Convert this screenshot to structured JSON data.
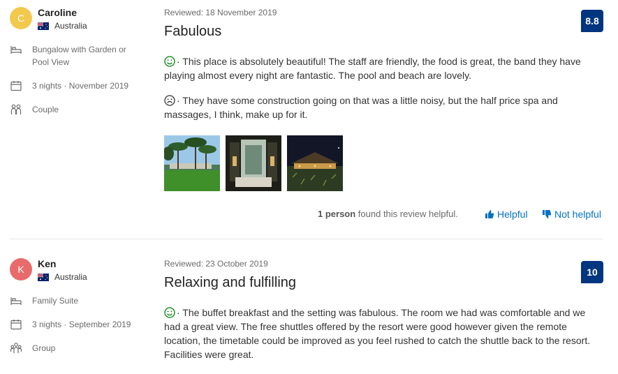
{
  "reviews": [
    {
      "avatar_letter": "C",
      "avatar_color": "#f2c94c",
      "name": "Caroline",
      "country": "Australia",
      "room": "Bungalow with Garden or Pool View",
      "nights": "3 nights ·",
      "stay_date": "November 2019",
      "traveler_type": "Couple",
      "reviewed": "Reviewed: 18 November 2019",
      "title": "Fabulous",
      "score": "8.8",
      "positive": "· This place is absolutely beautiful! The staff are friendly, the food is great, the band they have playing almost every night are fantastic. The pool and beach are lovely.",
      "negative": "· They have some construction going on that was a little noisy, but the half price spa and massages, I think, make up for it.",
      "helpful_bold": "1 person",
      "helpful_rest": " found this review helpful.",
      "helpful_label": "Helpful",
      "not_helpful_label": "Not helpful"
    },
    {
      "avatar_letter": "K",
      "avatar_color": "#e86a6a",
      "name": "Ken",
      "country": "Australia",
      "room": "Family Suite",
      "nights": "3 nights ·",
      "stay_date": "September 2019",
      "traveler_type": "Group",
      "reviewed": "Reviewed: 23 October 2019",
      "title": "Relaxing and fulfilling",
      "score": "10",
      "positive": "· The buffet breakfast and the setting was fabulous. The room we had was comfortable and we had a great view. The free shuttles offered by the resort were good however given the remote location, the timetable could be improved as you feel rushed to catch the shuttle back to the resort. Facilities were great."
    }
  ],
  "colors": {
    "score_bg": "#003580",
    "link": "#0071c2",
    "positive_face": "#008009",
    "negative_face": "#333333"
  }
}
